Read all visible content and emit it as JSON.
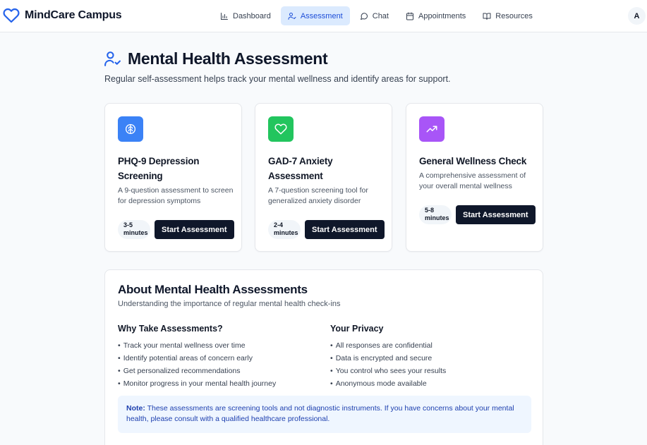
{
  "app": {
    "name": "MindCare Campus"
  },
  "nav": [
    {
      "label": "Dashboard",
      "icon": "bar-chart-icon"
    },
    {
      "label": "Assessment",
      "icon": "user-check-icon",
      "active": true
    },
    {
      "label": "Chat",
      "icon": "chat-bubble-icon"
    },
    {
      "label": "Appointments",
      "icon": "calendar-icon"
    },
    {
      "label": "Resources",
      "icon": "book-icon"
    }
  ],
  "user": {
    "initial": "A"
  },
  "page": {
    "title": "Mental Health Assessment",
    "subtitle": "Regular self-assessment helps track your mental wellness and identify areas for support."
  },
  "cards": [
    {
      "title": "PHQ-9 Depression Screening",
      "description": "A 9-question assessment to screen for depression symptoms",
      "time_value": "3-5",
      "time_unit": "minutes",
      "button": "Start Assessment",
      "icon": "brain-icon",
      "color": "#3b82f6"
    },
    {
      "title": "GAD-7 Anxiety Assessment",
      "description": "A 7-question screening tool for generalized anxiety disorder",
      "time_value": "2-4",
      "time_unit": "minutes",
      "button": "Start Assessment",
      "icon": "heart-icon",
      "color": "#22c55e"
    },
    {
      "title": "General Wellness Check",
      "description": "A comprehensive assessment of your overall mental wellness",
      "time_value": "5-8",
      "time_unit": "minutes",
      "button": "Start Assessment",
      "icon": "trending-up-icon",
      "color": "#a855f7"
    }
  ],
  "about": {
    "title": "About Mental Health Assessments",
    "subtitle": "Understanding the importance of regular mental health check-ins",
    "why": {
      "title": "Why Take Assessments?",
      "items": [
        "Track your mental wellness over time",
        "Identify potential areas of concern early",
        "Get personalized recommendations",
        "Monitor progress in your mental health journey"
      ]
    },
    "privacy": {
      "title": "Your Privacy",
      "items": [
        "All responses are confidential",
        "Data is encrypted and secure",
        "You control who sees your results",
        "Anonymous mode available"
      ]
    },
    "note": {
      "label": "Note:",
      "text": "These assessments are screening tools and not diagnostic instruments. If you have concerns about your mental health, please consult with a qualified healthcare professional."
    }
  },
  "colors": {
    "brand": "#2563eb",
    "nav_active_bg": "#dbeafe",
    "button_bg": "#0f172a",
    "note_bg": "#eff6ff"
  }
}
